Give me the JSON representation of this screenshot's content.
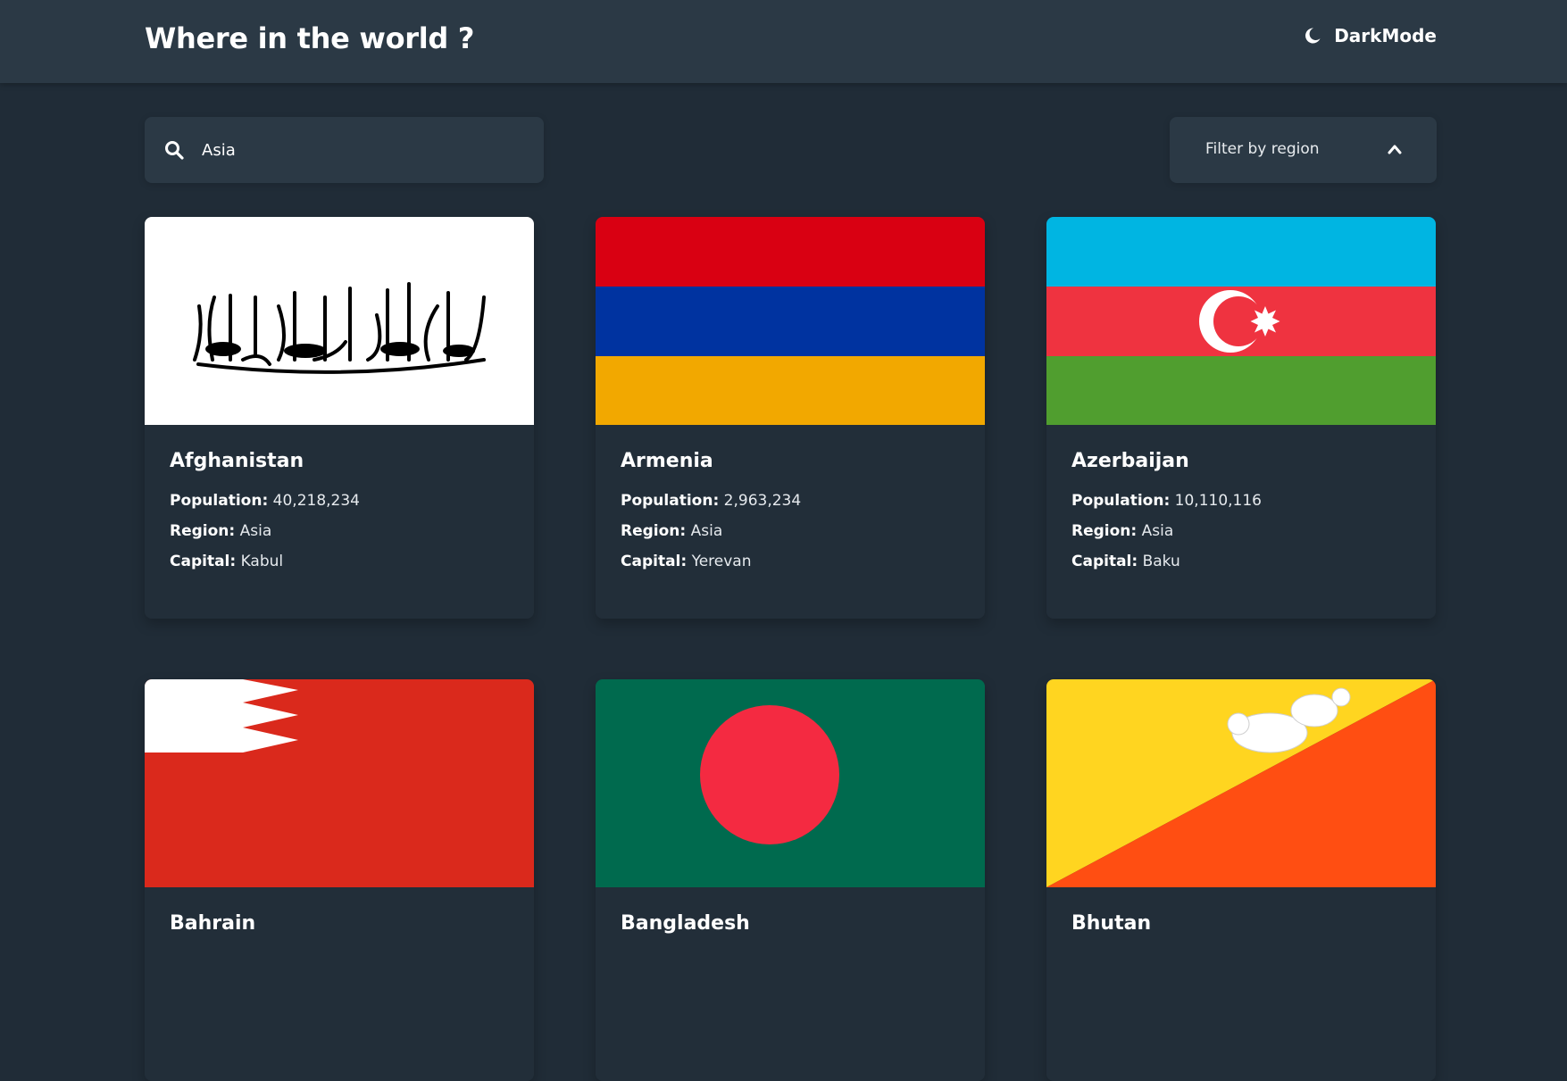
{
  "header": {
    "title": "Where in the world ?",
    "mode_label": "DarkMode"
  },
  "search": {
    "value": "Asia",
    "placeholder": ""
  },
  "filter": {
    "label": "Filter by region"
  },
  "labels": {
    "population": "Population:",
    "region": "Region:",
    "capital": "Capital:"
  },
  "countries": [
    {
      "name": "Afghanistan",
      "population": "40,218,234",
      "region": "Asia",
      "capital": "Kabul"
    },
    {
      "name": "Armenia",
      "population": "2,963,234",
      "region": "Asia",
      "capital": "Yerevan"
    },
    {
      "name": "Azerbaijan",
      "population": "10,110,116",
      "region": "Asia",
      "capital": "Baku"
    },
    {
      "name": "Bahrain"
    },
    {
      "name": "Bangladesh"
    },
    {
      "name": "Bhutan"
    }
  ],
  "colors": {
    "background": "#202c37",
    "elements": "#2b3945",
    "text": "#ffffff"
  }
}
